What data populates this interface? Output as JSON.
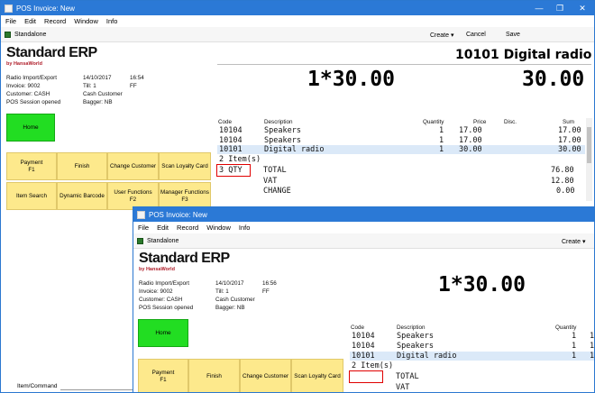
{
  "window_title": "POS Invoice: New",
  "window_controls": {
    "minimize": "—",
    "maximize": "❐",
    "close": "✕"
  },
  "menu": [
    "File",
    "Edit",
    "Record",
    "Window",
    "Info"
  ],
  "toolbar": {
    "context": "Standalone",
    "create_label": "Create",
    "cancel_label": "Cancel",
    "save_label": "Save"
  },
  "brand": {
    "logo": "Standard ERP",
    "sub": "by HansaWorld"
  },
  "info1": {
    "company": "Radio Import/Export",
    "date": "14/10/2017",
    "time": "16:54",
    "invoice": "Invoice: 9002",
    "till": "Till: 1",
    "till_code": "FF",
    "customer": "Customer: CASH",
    "customer_name": "Cash Customer",
    "session": "POS Session opened",
    "bagger": "Bagger: NB"
  },
  "info2": {
    "company": "Radio Import/Export",
    "date": "14/10/2017",
    "time": "16:56",
    "invoice": "Invoice: 9002",
    "till": "Till: 1",
    "till_code": "FF",
    "customer": "Customer: CASH",
    "customer_name": "Cash Customer",
    "session": "POS Session opened",
    "bagger": "Bagger: NB"
  },
  "display": {
    "item_title": "10101 Digital radio",
    "qty_price": "1*30.00",
    "amount": "30.00"
  },
  "grid_headers": {
    "code": "Code",
    "description": "Description",
    "quantity": "Quantity",
    "price": "Price",
    "disc": "Disc.",
    "sum": "Sum"
  },
  "rows": [
    {
      "code": "10104",
      "desc": "Speakers",
      "qty": "1",
      "price": "17.00",
      "sum": "17.00"
    },
    {
      "code": "10104",
      "desc": "Speakers",
      "qty": "1",
      "price": "17.00",
      "sum": "17.00"
    },
    {
      "code": "10101",
      "desc": "Digital radio",
      "qty": "1",
      "price": "30.00",
      "sum": "30.00"
    }
  ],
  "items_count": "2 Item(s)",
  "qty_entry": "3 QTY",
  "totals": [
    {
      "label": "TOTAL",
      "value": "76.80"
    },
    {
      "label": "VAT",
      "value": "12.80"
    },
    {
      "label": "CHANGE",
      "value": "0.00"
    }
  ],
  "buttons": {
    "home": "Home",
    "payment": "Payment",
    "payment_key": "F1",
    "finish": "Finish",
    "change_customer": "Change Customer",
    "scan_loyalty": "Scan Loyalty Card",
    "item_search": "Item Search",
    "dynamic_barcode": "Dynamic Barcode",
    "user_functions": "User Functions",
    "user_functions_key": "F2",
    "manager_functions": "Manager Functions",
    "manager_functions_key": "F3"
  },
  "item_command_label": "Item/Command"
}
